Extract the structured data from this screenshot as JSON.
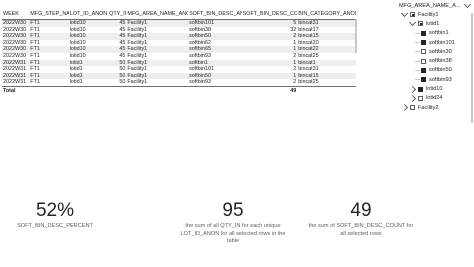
{
  "table": {
    "columns": [
      "WEEK",
      "MFG_STEP_NAME",
      "LOT_ID_ANON",
      "QTY_IN",
      "MFG_AREA_NAME_ANON",
      "SOFT_BIN_DESC_ANON",
      "SOFT_BIN_DESC_COUNT",
      "BIN_CATEGORY_ANON"
    ],
    "rows": [
      [
        "2022W30",
        "FT1",
        "lotid10",
        "45",
        "Facility1",
        "softbin101",
        "5",
        "bincat31"
      ],
      [
        "2022W30",
        "FT1",
        "lotid10",
        "45",
        "Facility1",
        "softbin38",
        "32",
        "bincat17"
      ],
      [
        "2022W30",
        "FT1",
        "lotid10",
        "45",
        "Facility1",
        "softbin50",
        "2",
        "bincat15"
      ],
      [
        "2022W30",
        "FT1",
        "lotid10",
        "45",
        "Facility1",
        "softbin62",
        "1",
        "bincat20"
      ],
      [
        "2022W30",
        "FT1",
        "lotid10",
        "45",
        "Facility1",
        "softbin65",
        "1",
        "bincat22"
      ],
      [
        "2022W30",
        "FT1",
        "lotid10",
        "45",
        "Facility1",
        "softbin93",
        "2",
        "bincat25"
      ],
      [
        "2022W31",
        "FT1",
        "lotid1",
        "50",
        "Facility1",
        "softbin1",
        "1",
        "bincat1"
      ],
      [
        "2022W31",
        "FT1",
        "lotid1",
        "50",
        "Facility1",
        "softbin101",
        "2",
        "bincat31"
      ],
      [
        "2022W31",
        "FT1",
        "lotid1",
        "50",
        "Facility1",
        "softbin50",
        "1",
        "bincat15"
      ],
      [
        "2022W31",
        "FT1",
        "lotid1",
        "50",
        "Facility1",
        "softbin93",
        "2",
        "bincat25"
      ]
    ],
    "total_label": "Total",
    "total_count": "49"
  },
  "slicer": {
    "title": "MFG_AREA_NAME_A...",
    "nodes": [
      {
        "label": "Facility1",
        "level": 0,
        "expand": "down",
        "check": "partial"
      },
      {
        "label": "lotid1",
        "level": 1,
        "expand": "down",
        "check": "partial"
      },
      {
        "label": "softbin1",
        "level": 2,
        "expand": "",
        "check": "full"
      },
      {
        "label": "softbin101",
        "level": 2,
        "expand": "",
        "check": "full"
      },
      {
        "label": "softbin30",
        "level": 2,
        "expand": "",
        "check": "empty"
      },
      {
        "label": "softbin38",
        "level": 2,
        "expand": "",
        "check": "empty"
      },
      {
        "label": "softbin50",
        "level": 2,
        "expand": "",
        "check": "full"
      },
      {
        "label": "softbin93",
        "level": 2,
        "expand": "",
        "check": "full"
      },
      {
        "label": "lotid10",
        "level": 1,
        "expand": "right",
        "check": "full"
      },
      {
        "label": "lotid24",
        "level": 1,
        "expand": "right",
        "check": "empty"
      },
      {
        "label": "Facility2",
        "level": 0,
        "expand": "right",
        "check": "empty"
      }
    ]
  },
  "cards": {
    "pct": {
      "value": "52%",
      "label": "SOFT_BIN_DESC_PERCENT"
    },
    "qty": {
      "value": "95",
      "label": "the sum of all QTY_IN for each unique LOT_ID_ANON for all selected rows in the table"
    },
    "count": {
      "value": "49",
      "label": "the sum of SOFT_BIN_DESC_COUNT for all selected rows"
    }
  }
}
